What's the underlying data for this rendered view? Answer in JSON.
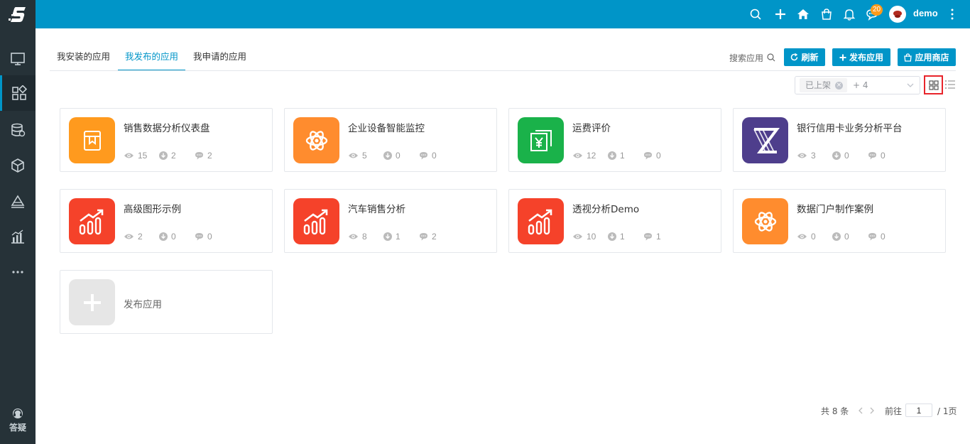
{
  "topbar": {
    "message_badge": "20",
    "username": "demo",
    "icons": [
      "search-icon",
      "plus-icon",
      "home-icon",
      "bag-icon",
      "bell-icon",
      "message-icon",
      "avatar",
      "more-vertical-icon"
    ]
  },
  "sidebar": {
    "items": [
      "monitor-icon",
      "apps-icon",
      "database-icon",
      "cube-icon",
      "layers-icon",
      "chart-icon",
      "more-horizontal-icon"
    ],
    "help_label": "答疑"
  },
  "tabs": [
    {
      "label": "我安装的应用",
      "active": false
    },
    {
      "label": "我发布的应用",
      "active": true
    },
    {
      "label": "我申请的应用",
      "active": false
    }
  ],
  "toolbar": {
    "search_label": "搜索应用",
    "refresh_label": "刷新",
    "publish_label": "发布应用",
    "store_label": "应用商店"
  },
  "filter": {
    "tag": "已上架",
    "more": "+ 4"
  },
  "apps": [
    {
      "title": "销售数据分析仪表盘",
      "views": "15",
      "downloads": "2",
      "comments": "2",
      "icon": "book-icon",
      "color": "#ff9a1e"
    },
    {
      "title": "企业设备智能监控",
      "views": "5",
      "downloads": "0",
      "comments": "0",
      "icon": "atom-icon",
      "color": "#ff8c2e"
    },
    {
      "title": "运费评价",
      "views": "12",
      "downloads": "1",
      "comments": "0",
      "icon": "yuan-icon",
      "color": "#1ab24a"
    },
    {
      "title": "银行信用卡业务分析平台",
      "views": "3",
      "downloads": "0",
      "comments": "0",
      "icon": "z-logo-icon",
      "color": "#4e3e8c"
    },
    {
      "title": "高级图形示例",
      "views": "2",
      "downloads": "0",
      "comments": "0",
      "icon": "growth-chart-icon",
      "color": "#f5422a"
    },
    {
      "title": "汽车销售分析",
      "views": "8",
      "downloads": "1",
      "comments": "2",
      "icon": "growth-chart-icon",
      "color": "#f5422a"
    },
    {
      "title": "透视分析Demo",
      "views": "10",
      "downloads": "1",
      "comments": "1",
      "icon": "growth-chart-icon",
      "color": "#f5422a"
    },
    {
      "title": "数据门户制作案例",
      "views": "0",
      "downloads": "0",
      "comments": "0",
      "icon": "atom-icon",
      "color": "#ff8c2e"
    }
  ],
  "add_card": {
    "title": "发布应用"
  },
  "pagination": {
    "total": "共 8 条",
    "goto_label": "前往",
    "page": "1",
    "pages_label": "/ 1页"
  }
}
